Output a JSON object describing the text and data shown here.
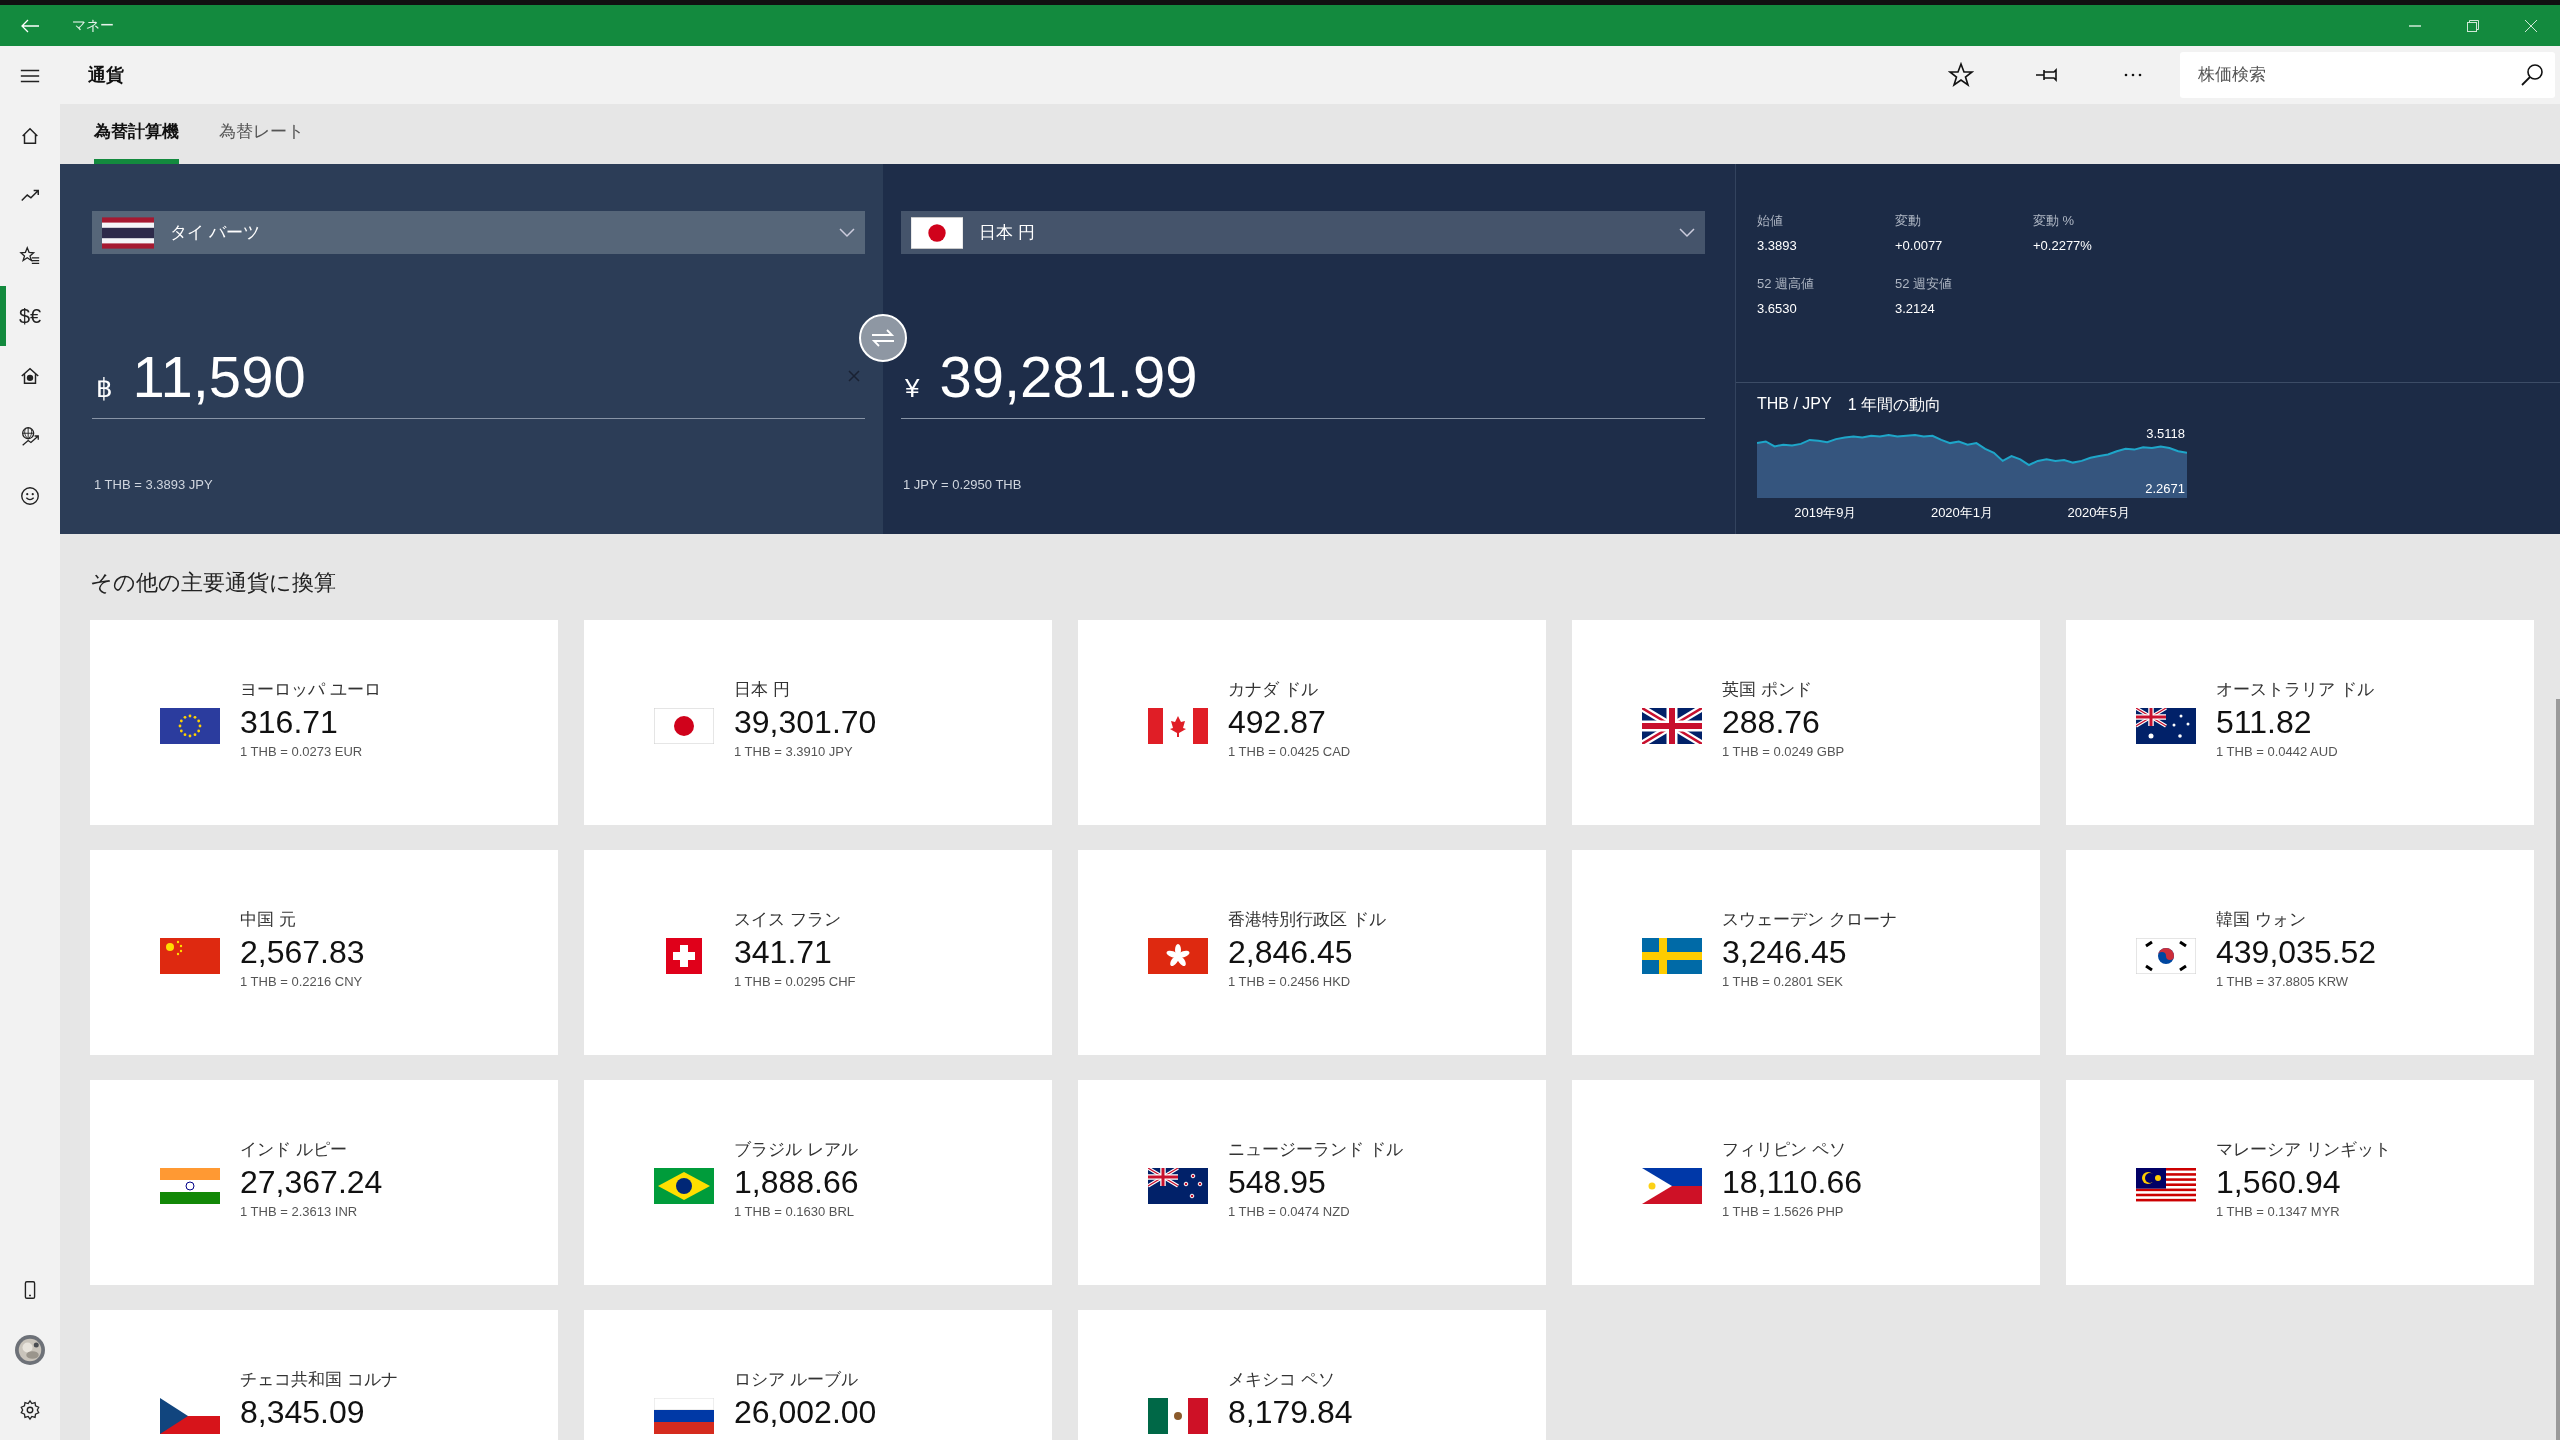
{
  "window": {
    "title": "マネー"
  },
  "header": {
    "title": "通貨",
    "search": {
      "placeholder": "株価検索"
    }
  },
  "sidebar": {
    "items": [
      {
        "kind": "home",
        "selected": false
      },
      {
        "kind": "trend",
        "selected": false
      },
      {
        "kind": "watchlist",
        "selected": false
      },
      {
        "kind": "currency",
        "glyph": "$€",
        "selected": true
      },
      {
        "kind": "mortgage",
        "selected": false
      },
      {
        "kind": "world",
        "selected": false
      },
      {
        "kind": "smiley",
        "selected": false
      }
    ],
    "bottom": [
      {
        "kind": "phone"
      },
      {
        "kind": "avatar"
      },
      {
        "kind": "settings"
      }
    ]
  },
  "tabs": [
    {
      "label": "為替計算機",
      "selected": true
    },
    {
      "label": "為替レート",
      "selected": false
    }
  ],
  "converter": {
    "from": {
      "kind": "th",
      "currency": "タイ バーツ",
      "symbol": "฿",
      "amount": "11,590",
      "rate": "1 THB = 3.3893 JPY"
    },
    "to": {
      "kind": "jp",
      "currency": "日本 円",
      "symbol": "¥",
      "amount": "39,281.99",
      "rate": "1 JPY = 0.2950 THB"
    }
  },
  "stats": [
    {
      "label": "始値",
      "value": "3.3893"
    },
    {
      "label": "変動",
      "value": "+0.0077"
    },
    {
      "label": "変動 %",
      "value": "+0.2277%"
    },
    {
      "label": "52 週高値",
      "value": "3.6530"
    },
    {
      "label": "52 週安値",
      "value": "3.2124"
    }
  ],
  "trend": {
    "pair": "THB / JPY",
    "title": "1 年間の動向",
    "max_label": "3.5118",
    "min_label": "2.2671",
    "x_labels": [
      "2019年9月",
      "2020年1月",
      "2020年5月"
    ]
  },
  "section_title": "その他の主要通貨に換算",
  "conversions": [
    {
      "kind": "eu",
      "name": "ヨーロッパ ユーロ",
      "amount": "316.71",
      "rate": "1 THB = 0.0273 EUR"
    },
    {
      "kind": "jp",
      "name": "日本 円",
      "amount": "39,301.70",
      "rate": "1 THB = 3.3910 JPY"
    },
    {
      "kind": "ca",
      "name": "カナダ ドル",
      "amount": "492.87",
      "rate": "1 THB = 0.0425 CAD"
    },
    {
      "kind": "gb",
      "name": "英国 ポンド",
      "amount": "288.76",
      "rate": "1 THB = 0.0249 GBP"
    },
    {
      "kind": "au",
      "name": "オーストラリア ドル",
      "amount": "511.82",
      "rate": "1 THB = 0.0442 AUD"
    },
    {
      "kind": "cn",
      "name": "中国 元",
      "amount": "2,567.83",
      "rate": "1 THB = 0.2216 CNY"
    },
    {
      "kind": "ch",
      "name": "スイス フラン",
      "amount": "341.71",
      "rate": "1 THB = 0.0295 CHF"
    },
    {
      "kind": "hk",
      "name": "香港特別行政区 ドル",
      "amount": "2,846.45",
      "rate": "1 THB = 0.2456 HKD"
    },
    {
      "kind": "se",
      "name": "スウェーデン クローナ",
      "amount": "3,246.45",
      "rate": "1 THB = 0.2801 SEK"
    },
    {
      "kind": "kr",
      "name": "韓国 ウォン",
      "amount": "439,035.52",
      "rate": "1 THB = 37.8805 KRW"
    },
    {
      "kind": "in",
      "name": "インド ルピー",
      "amount": "27,367.24",
      "rate": "1 THB = 2.3613 INR"
    },
    {
      "kind": "br",
      "name": "ブラジル レアル",
      "amount": "1,888.66",
      "rate": "1 THB = 0.1630 BRL"
    },
    {
      "kind": "nz",
      "name": "ニュージーランド ドル",
      "amount": "548.95",
      "rate": "1 THB = 0.0474 NZD"
    },
    {
      "kind": "ph",
      "name": "フィリピン ペソ",
      "amount": "18,110.66",
      "rate": "1 THB = 1.5626 PHP"
    },
    {
      "kind": "my",
      "name": "マレーシア リンギット",
      "amount": "1,560.94",
      "rate": "1 THB = 0.1347 MYR"
    },
    {
      "kind": "cz",
      "name": "チェコ共和国 コルナ",
      "amount": "8,345.09"
    },
    {
      "kind": "ru",
      "name": "ロシア ルーブル",
      "amount": "26,002.00"
    },
    {
      "kind": "mx",
      "name": "メキシコ ペソ",
      "amount": "8,179.84"
    }
  ]
}
